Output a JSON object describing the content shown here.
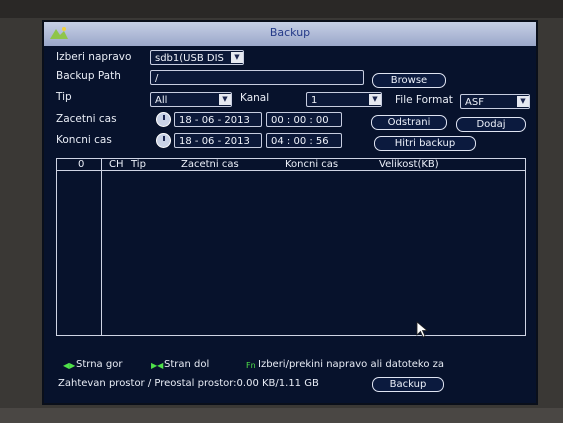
{
  "window": {
    "title": "Backup"
  },
  "device": {
    "label": "Izberi napravo",
    "value": "sdb1(USB DIS"
  },
  "backup_path": {
    "label": "Backup Path",
    "value": "/",
    "browse_label": "Browse"
  },
  "type": {
    "label": "Tip",
    "value": "All"
  },
  "channel": {
    "label": "Kanal",
    "value": "1"
  },
  "file_format": {
    "label": "File Format",
    "value": "ASF"
  },
  "start": {
    "label": "Zacetni cas",
    "date": "18 - 06 - 2013",
    "time": "00 : 00 : 00"
  },
  "end": {
    "label": "Koncni cas",
    "date": "18 - 06 - 2013",
    "time": "04 : 00 : 56"
  },
  "buttons": {
    "remove": "Odstrani",
    "add": "Dodaj",
    "quick_backup": "Hitri backup",
    "backup": "Backup"
  },
  "table": {
    "columns": [
      "0",
      "CH",
      "Tip",
      "Zacetni cas",
      "Koncni cas",
      "Velikost(KB)"
    ]
  },
  "footer": {
    "page_up": "Strna gor",
    "page_down": "Stran dol",
    "select_hint": "Izberi/prekini napravo ali datoteko za",
    "space_info": "Zahtevan prostor / Preostal prostor:0.00 KB/1.11 GB"
  },
  "colors": {
    "screen_bg": "#07122c",
    "title_bar": "#aeb8d6",
    "legend_icon": "#4fe24a"
  }
}
